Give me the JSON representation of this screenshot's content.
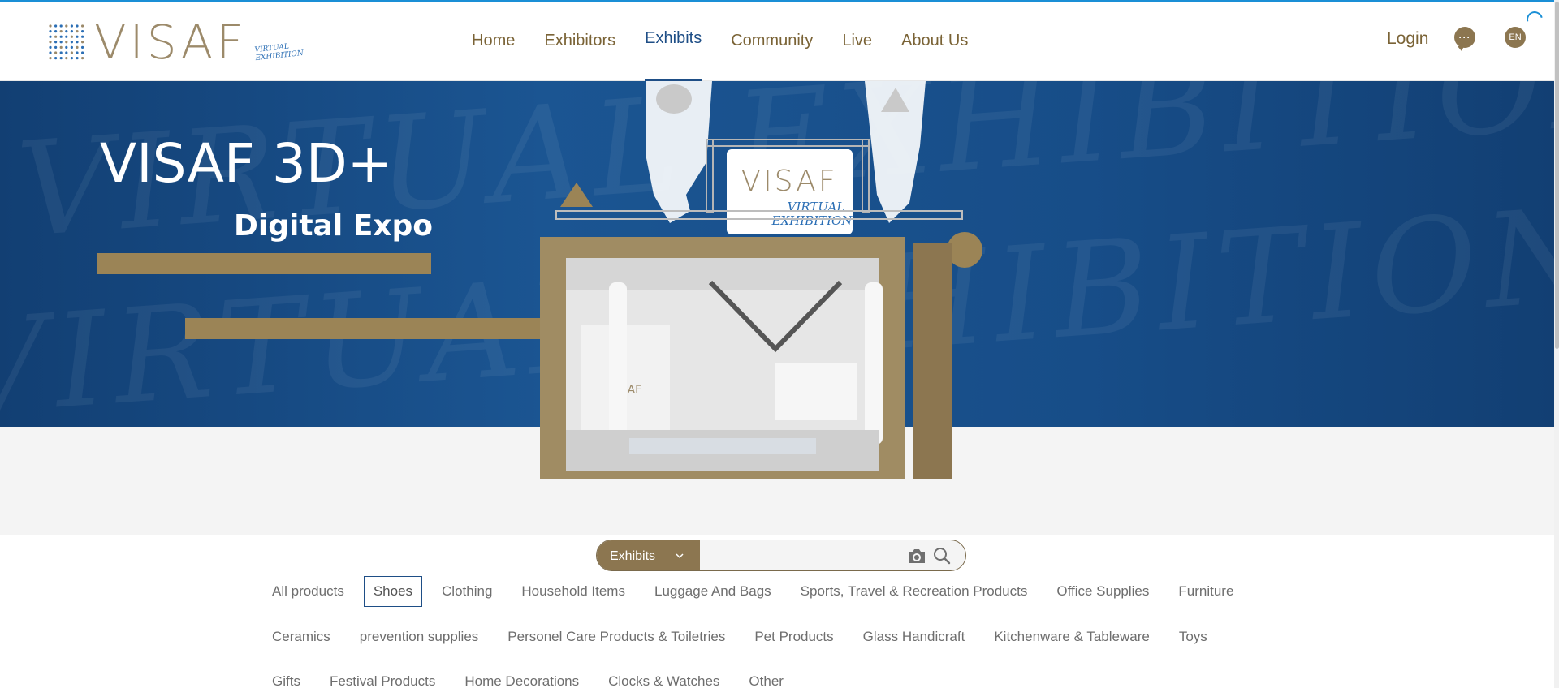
{
  "header": {
    "logo": {
      "text": "VISAF",
      "subtitle_line1": "VIRTUAL",
      "subtitle_line2": "EXHIBITION"
    },
    "nav": [
      {
        "label": "Home",
        "active": false
      },
      {
        "label": "Exhibitors",
        "active": false
      },
      {
        "label": "Exhibits",
        "active": true
      },
      {
        "label": "Community",
        "active": false
      },
      {
        "label": "Live",
        "active": false
      },
      {
        "label": "About Us",
        "active": false
      }
    ],
    "login_label": "Login",
    "chat_icon": "chat-bubble-icon",
    "language": "EN"
  },
  "hero": {
    "title": "VISAF 3D+",
    "subtitle": "Digital Expo",
    "booth_sign_title": "VISAF",
    "booth_sign_sub1": "VIRTUAL",
    "booth_sign_sub2": "EXHIBITION",
    "booth_inner_sign": "VISAF"
  },
  "search": {
    "type_label": "Exhibits",
    "placeholder": "",
    "camera_icon": "camera-icon",
    "search_icon": "search-icon"
  },
  "categories": {
    "selected": "Shoes",
    "row1": [
      "All products",
      "Shoes",
      "Clothing",
      "Household Items",
      "Luggage And Bags",
      "Sports, Travel & Recreation Products",
      "Office Supplies",
      "Furniture"
    ],
    "row2": [
      "Ceramics",
      "prevention supplies",
      "Personel Care Products & Toiletries",
      "Pet Products",
      "Glass Handicraft",
      "Kitchenware & Tableware",
      "Toys"
    ],
    "row3": [
      "Gifts",
      "Festival Products",
      "Home Decorations",
      "Clocks & Watches",
      "Other"
    ]
  },
  "colors": {
    "brand_gold": "#8c7650",
    "nav_text": "#7a6336",
    "active_blue": "#1e4e86",
    "hero_blue": "#174d88"
  }
}
